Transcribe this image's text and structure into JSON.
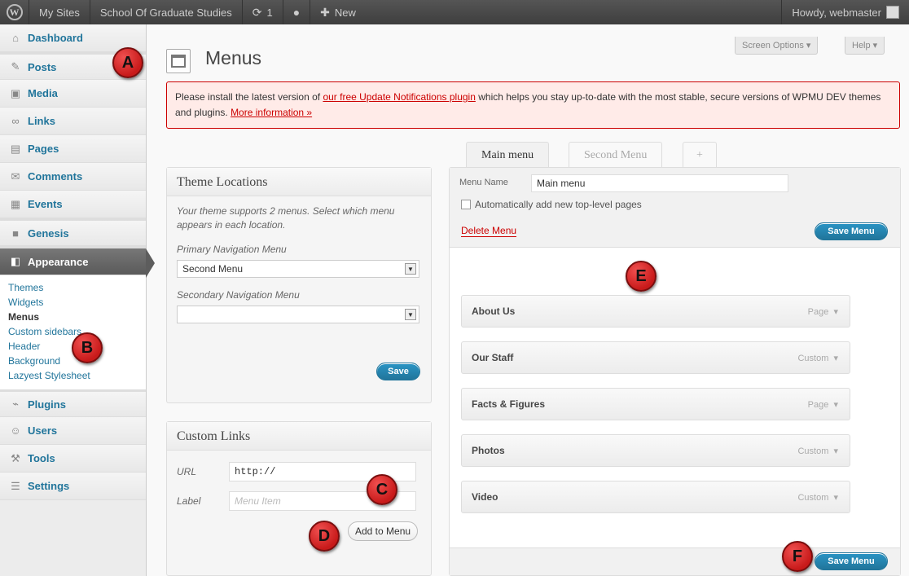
{
  "adminbar": {
    "my_sites": "My Sites",
    "site_name": "School Of Graduate Studies",
    "updates_count": "1",
    "new_label": "New",
    "howdy": "Howdy, webmaster"
  },
  "sidebar": {
    "items": [
      {
        "label": "Dashboard"
      },
      {
        "label": "Posts"
      },
      {
        "label": "Media"
      },
      {
        "label": "Links"
      },
      {
        "label": "Pages"
      },
      {
        "label": "Comments"
      },
      {
        "label": "Events"
      },
      {
        "label": "Genesis"
      },
      {
        "label": "Appearance"
      },
      {
        "label": "Plugins"
      },
      {
        "label": "Users"
      },
      {
        "label": "Tools"
      },
      {
        "label": "Settings"
      }
    ],
    "submenu": [
      "Themes",
      "Widgets",
      "Menus",
      "Custom sidebars",
      "Header",
      "Background",
      "Lazyest Stylesheet"
    ]
  },
  "page": {
    "title": "Menus",
    "screen_options": "Screen Options ▾",
    "help": "Help ▾"
  },
  "notice": {
    "text_before": "Please install the latest version of ",
    "plugin_link": "our free Update Notifications plugin",
    "text_after": " which helps you stay up-to-date with the most stable, secure versions of WPMU DEV themes and plugins. ",
    "more_link": "More information »"
  },
  "theme_locations": {
    "title": "Theme Locations",
    "description": "Your theme supports 2 menus. Select which menu appears in each location.",
    "primary_label": "Primary Navigation Menu",
    "primary_value": "Second Menu",
    "secondary_label": "Secondary Navigation Menu",
    "secondary_value": "",
    "save_label": "Save"
  },
  "custom_links": {
    "title": "Custom Links",
    "url_label": "URL",
    "url_value": "http://",
    "label_label": "Label",
    "label_placeholder": "Menu Item",
    "add_button": "Add to Menu"
  },
  "tabs": {
    "main": "Main menu",
    "second": "Second Menu",
    "add": "+"
  },
  "menu_editor": {
    "name_label": "Menu Name",
    "name_value": "Main menu",
    "auto_add_label": "Automatically add new top-level pages",
    "delete_label": "Delete Menu",
    "save_label": "Save Menu",
    "items": [
      {
        "title": "About Us",
        "type": "Page"
      },
      {
        "title": "Our Staff",
        "type": "Custom"
      },
      {
        "title": "Facts & Figures",
        "type": "Page"
      },
      {
        "title": "Photos",
        "type": "Custom"
      },
      {
        "title": "Video",
        "type": "Custom"
      }
    ]
  },
  "markers": {
    "a": "A",
    "b": "B",
    "c": "C",
    "d": "D",
    "e": "E",
    "f": "F"
  },
  "colors": {
    "link": "#21759b",
    "notice_bg": "#ffebe8",
    "notice_border": "#cc0000",
    "marker": "#d32020"
  }
}
